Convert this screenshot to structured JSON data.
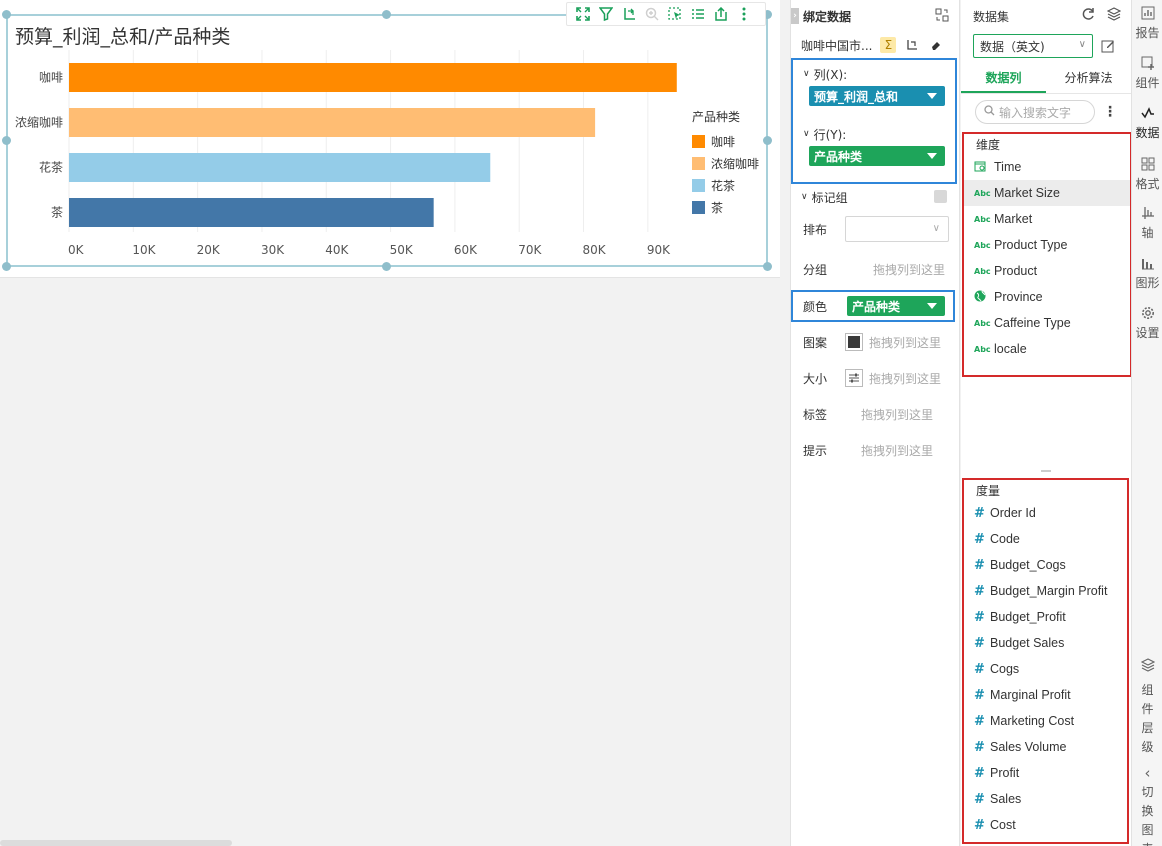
{
  "chart": {
    "title": "预算_利润_总和/产品种类",
    "legend_title": "产品种类",
    "toolbar_icons": [
      "expand-icon",
      "filter-icon",
      "swap-axes-icon",
      "zoom-icon",
      "select-icon",
      "list-icon",
      "export-icon",
      "more-icon"
    ]
  },
  "chart_data": {
    "type": "bar",
    "orientation": "horizontal",
    "categories": [
      "咖啡",
      "浓缩咖啡",
      "花茶",
      "茶"
    ],
    "values": [
      94500,
      81800,
      65500,
      56700
    ],
    "colors": [
      "#ff8a00",
      "#ffbd73",
      "#94cce8",
      "#4377a8"
    ],
    "x_ticks": [
      "0K",
      "10K",
      "20K",
      "30K",
      "40K",
      "50K",
      "60K",
      "70K",
      "80K",
      "90K"
    ],
    "xlim": [
      0,
      95000
    ],
    "legend": [
      "咖啡",
      "浓缩咖啡",
      "花茶",
      "茶"
    ],
    "legend_position": "right",
    "grid": true
  },
  "binding": {
    "title": "绑定数据",
    "source": "咖啡中国市...",
    "columns_label": "列(X):",
    "columns_field": "预算_利润_总和",
    "rows_label": "行(Y):",
    "rows_field": "产品种类",
    "mark_group": "标记组",
    "layout_label": "排布",
    "group_label": "分组",
    "group_hint": "拖拽列到这里",
    "color_label": "颜色",
    "color_field": "产品种类",
    "pattern_label": "图案",
    "pattern_hint": "拖拽列到这里",
    "size_label": "大小",
    "size_hint": "拖拽列到这里",
    "label_label": "标签",
    "label_hint": "拖拽列到这里",
    "tip_label": "提示",
    "tip_hint": "拖拽列到这里"
  },
  "dataset": {
    "title": "数据集",
    "selected": "数据（英文)",
    "tabs": [
      "数据列",
      "分析算法"
    ],
    "search_placeholder": "输入搜索文字",
    "dimensions_title": "维度",
    "dimensions": [
      "Time",
      "Market Size",
      "Market",
      "Product Type",
      "Product",
      "Province",
      "Caffeine Type",
      "locale"
    ],
    "measures_title": "度量",
    "measures": [
      "Order Id",
      "Code",
      "Budget_Cogs",
      "Budget_Margin Profit",
      "Budget_Profit",
      "Budget Sales",
      "Cogs",
      "Marginal Profit",
      "Marketing Cost",
      "Sales Volume",
      "Profit",
      "Sales",
      "Cost"
    ]
  },
  "rail": {
    "report": "报告",
    "component": "组件",
    "data": "数据",
    "format": "格式",
    "axis": "轴",
    "shape": "图形",
    "settings": "设置",
    "layers": "组件层级",
    "switch": "切换图表"
  }
}
